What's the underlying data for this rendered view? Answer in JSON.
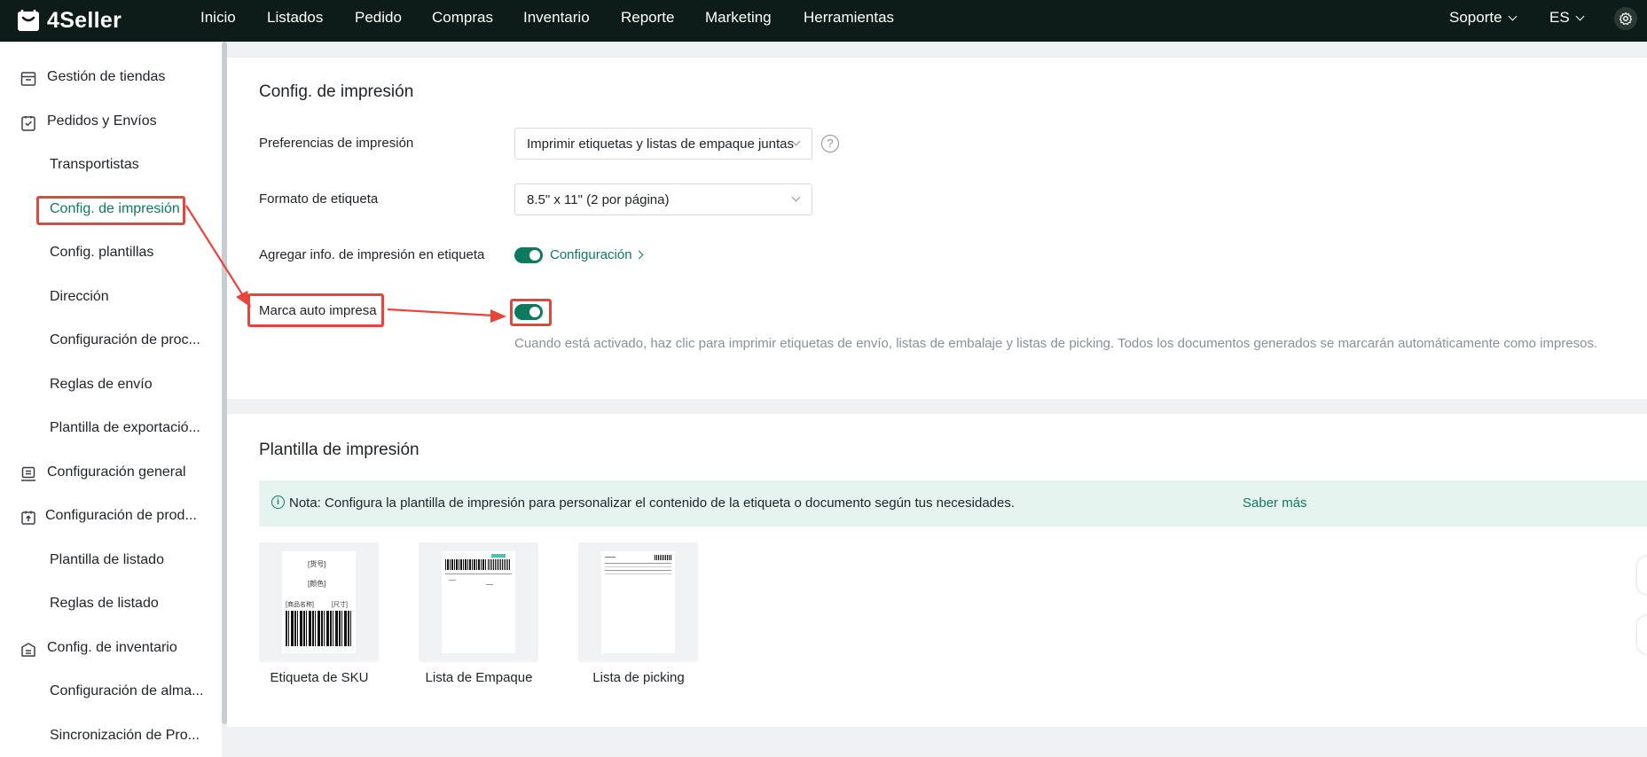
{
  "header": {
    "logo_text": "4Seller",
    "nav": [
      "Inicio",
      "Listados",
      "Pedido",
      "Compras",
      "Inventario",
      "Reporte",
      "Marketing",
      "Herramientas"
    ],
    "support_label": "Soporte",
    "language_label": "ES"
  },
  "sidebar": {
    "items": [
      {
        "label": "Gestión de tiendas",
        "icon": "store-icon",
        "level": 1
      },
      {
        "label": "Pedidos y Envíos",
        "icon": "order-icon",
        "level": 1
      },
      {
        "label": "Transportistas",
        "level": 2
      },
      {
        "label": "Config. de impresión",
        "level": 2,
        "active": true
      },
      {
        "label": "Config. plantillas",
        "level": 2
      },
      {
        "label": "Dirección",
        "level": 2
      },
      {
        "label": "Configuración de proc...",
        "level": 2
      },
      {
        "label": "Reglas de envío",
        "level": 2
      },
      {
        "label": "Plantilla de exportació...",
        "level": 2
      },
      {
        "label": "Configuración general",
        "icon": "general-config-icon",
        "level": 1
      },
      {
        "label": "Configuración de prod...",
        "icon": "product-config-icon",
        "level": 1
      },
      {
        "label": "Plantilla de listado",
        "level": 2
      },
      {
        "label": "Reglas de listado",
        "level": 2
      },
      {
        "label": "Config. de inventario",
        "icon": "inventory-icon",
        "level": 1
      },
      {
        "label": "Configuración de alma...",
        "level": 2
      },
      {
        "label": "Sincronización de Pro...",
        "level": 2
      }
    ]
  },
  "print_config": {
    "title": "Config. de impresión",
    "preferences_label": "Preferencias de impresión",
    "preferences_value": "Imprimir etiquetas y listas de empaque juntas",
    "label_format_label": "Formato de etiqueta",
    "label_format_value": "8.5\" x 11\" (2 por página)",
    "add_info_label": "Agregar info. de impresión en etiqueta",
    "add_info_enabled": true,
    "config_link": "Configuración",
    "auto_mark_label": "Marca auto impresa",
    "auto_mark_enabled": true,
    "auto_mark_hint": "Cuando está activado, haz clic para imprimir etiquetas de envío, listas de embalaje y listas de picking. Todos los documentos generados se marcarán automáticamente como impresos."
  },
  "print_template": {
    "title": "Plantilla de impresión",
    "notice_text": "Nota: Configura la plantilla de impresión para personalizar el contenido de la etiqueta o documento según tus necesidades.",
    "notice_link": "Saber más",
    "templates": [
      "Etiqueta de SKU",
      "Lista de Empaque",
      "Lista de picking"
    ],
    "sku_preview_text": [
      "[货号]",
      "[颜色]",
      "[商品名称]",
      "[尺寸]"
    ]
  },
  "colors": {
    "topbar_bg": "#0d1c18",
    "brand_green": "#0d7a5f",
    "annotation_red": "#e8443a"
  }
}
